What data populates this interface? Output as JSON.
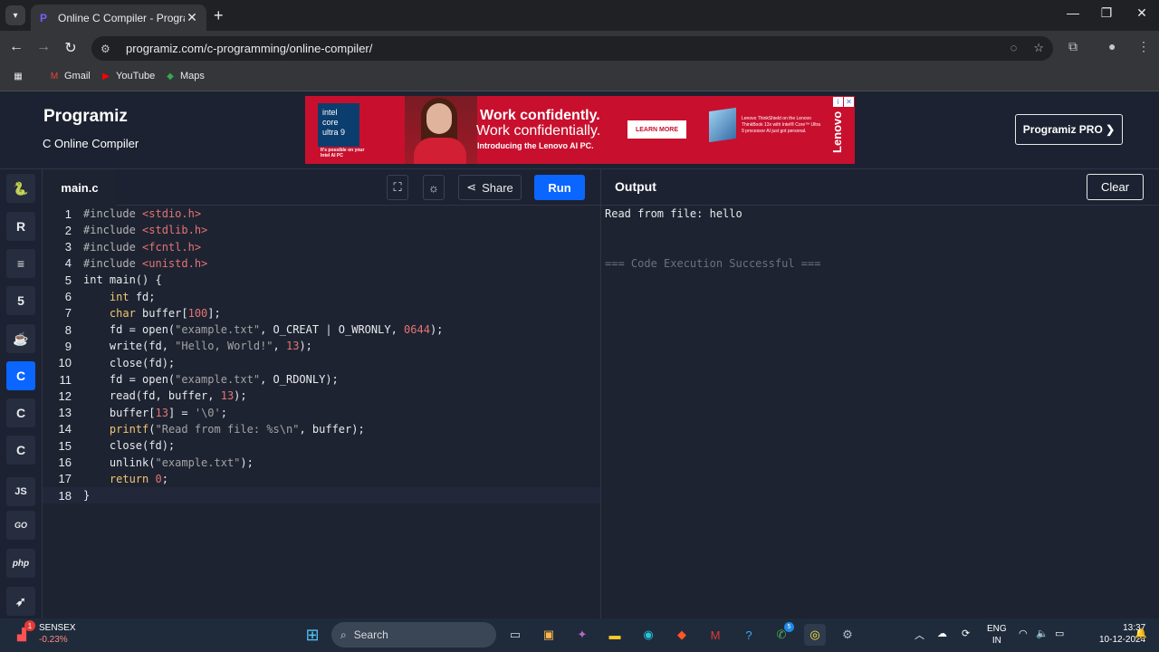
{
  "browser": {
    "tab_title": "Online C Compiler - Programiz",
    "url": "programiz.com/c-programming/online-compiler/",
    "bookmarks": [
      "Gmail",
      "YouTube",
      "Maps"
    ]
  },
  "site": {
    "logo": "Programiz",
    "subtitle": "C Online Compiler",
    "pro_button": "Programiz PRO ❯"
  },
  "ad": {
    "intel_label": "intel core ultra 9",
    "intel_note": "It's possible on your Intel AI PC",
    "headline1": "Work confidently.",
    "headline2": "Work confidentially.",
    "headline3": "Introducing the Lenovo AI PC.",
    "learn_more": "LEARN MORE",
    "small_text": "Lenovo ThinkShield on the Lenovo ThinkBook 13x with Intel® Core™ Ultra 9 processor AI just got personal.",
    "brand": "Lenovo"
  },
  "editor": {
    "file_tab": "main.c",
    "share_label": "Share",
    "run_label": "Run",
    "line_numbers": [
      "1",
      "2",
      "3",
      "4",
      "5",
      "6",
      "7",
      "8",
      "9",
      "10",
      "11",
      "12",
      "13",
      "14",
      "15",
      "16",
      "17",
      "18"
    ],
    "lines": [
      [
        {
          "t": "#include ",
          "c": "inc"
        },
        {
          "t": "<stdio.h>",
          "c": "hdr"
        }
      ],
      [
        {
          "t": "#include ",
          "c": "inc"
        },
        {
          "t": "<stdlib.h>",
          "c": "hdr"
        }
      ],
      [
        {
          "t": "#include ",
          "c": "inc"
        },
        {
          "t": "<fcntl.h>",
          "c": "hdr"
        }
      ],
      [
        {
          "t": "#include ",
          "c": "inc"
        },
        {
          "t": "<unistd.h>",
          "c": "hdr"
        }
      ],
      [
        {
          "t": "int",
          "c": ""
        },
        {
          "t": " main() {",
          "c": ""
        }
      ],
      [
        {
          "t": "    ",
          "c": ""
        },
        {
          "t": "int",
          "c": "kw"
        },
        {
          "t": " fd;",
          "c": ""
        }
      ],
      [
        {
          "t": "    ",
          "c": ""
        },
        {
          "t": "char",
          "c": "kw"
        },
        {
          "t": " buffer[",
          "c": ""
        },
        {
          "t": "100",
          "c": "num"
        },
        {
          "t": "];",
          "c": ""
        }
      ],
      [
        {
          "t": "    fd = open(",
          "c": ""
        },
        {
          "t": "\"example.txt\"",
          "c": "str"
        },
        {
          "t": ", O_CREAT | O_WRONLY, ",
          "c": ""
        },
        {
          "t": "0644",
          "c": "num"
        },
        {
          "t": ");",
          "c": ""
        }
      ],
      [
        {
          "t": "    write(fd, ",
          "c": ""
        },
        {
          "t": "\"Hello, World!\"",
          "c": "str"
        },
        {
          "t": ", ",
          "c": ""
        },
        {
          "t": "13",
          "c": "num"
        },
        {
          "t": ");",
          "c": ""
        }
      ],
      [
        {
          "t": "    close(fd);",
          "c": ""
        }
      ],
      [
        {
          "t": "    fd = open(",
          "c": ""
        },
        {
          "t": "\"example.txt\"",
          "c": "str"
        },
        {
          "t": ", O_RDONLY);",
          "c": ""
        }
      ],
      [
        {
          "t": "    read(fd, buffer, ",
          "c": ""
        },
        {
          "t": "13",
          "c": "num"
        },
        {
          "t": ");",
          "c": ""
        }
      ],
      [
        {
          "t": "    buffer[",
          "c": ""
        },
        {
          "t": "13",
          "c": "num"
        },
        {
          "t": "] = ",
          "c": ""
        },
        {
          "t": "'\\0'",
          "c": "str"
        },
        {
          "t": ";",
          "c": ""
        }
      ],
      [
        {
          "t": "    ",
          "c": ""
        },
        {
          "t": "printf",
          "c": "kw"
        },
        {
          "t": "(",
          "c": ""
        },
        {
          "t": "\"Read from file: %s\\n\"",
          "c": "str"
        },
        {
          "t": ", buffer);",
          "c": ""
        }
      ],
      [
        {
          "t": "    close(fd);",
          "c": ""
        }
      ],
      [
        {
          "t": "    unlink(",
          "c": ""
        },
        {
          "t": "\"example.txt\"",
          "c": "str"
        },
        {
          "t": ");",
          "c": ""
        }
      ],
      [
        {
          "t": "    ",
          "c": ""
        },
        {
          "t": "return",
          "c": "kw"
        },
        {
          "t": " ",
          "c": ""
        },
        {
          "t": "0",
          "c": "num"
        },
        {
          "t": ";",
          "c": ""
        }
      ],
      [
        {
          "t": "}",
          "c": ""
        }
      ]
    ]
  },
  "output": {
    "title": "Output",
    "clear_label": "Clear",
    "line1": "Read from file: hello",
    "line2": "=== Code Execution Successful ==="
  },
  "taskbar": {
    "sensex_label": "SENSEX",
    "sensex_change": "-0.23%",
    "search_placeholder": "Search",
    "lang1": "ENG",
    "lang2": "IN",
    "time": "13:37",
    "date": "10-12-2024",
    "badge_count": "1",
    "whatsapp_badge": "5"
  },
  "colors": {
    "accent": "#0a66ff",
    "background": "#1e2331"
  }
}
